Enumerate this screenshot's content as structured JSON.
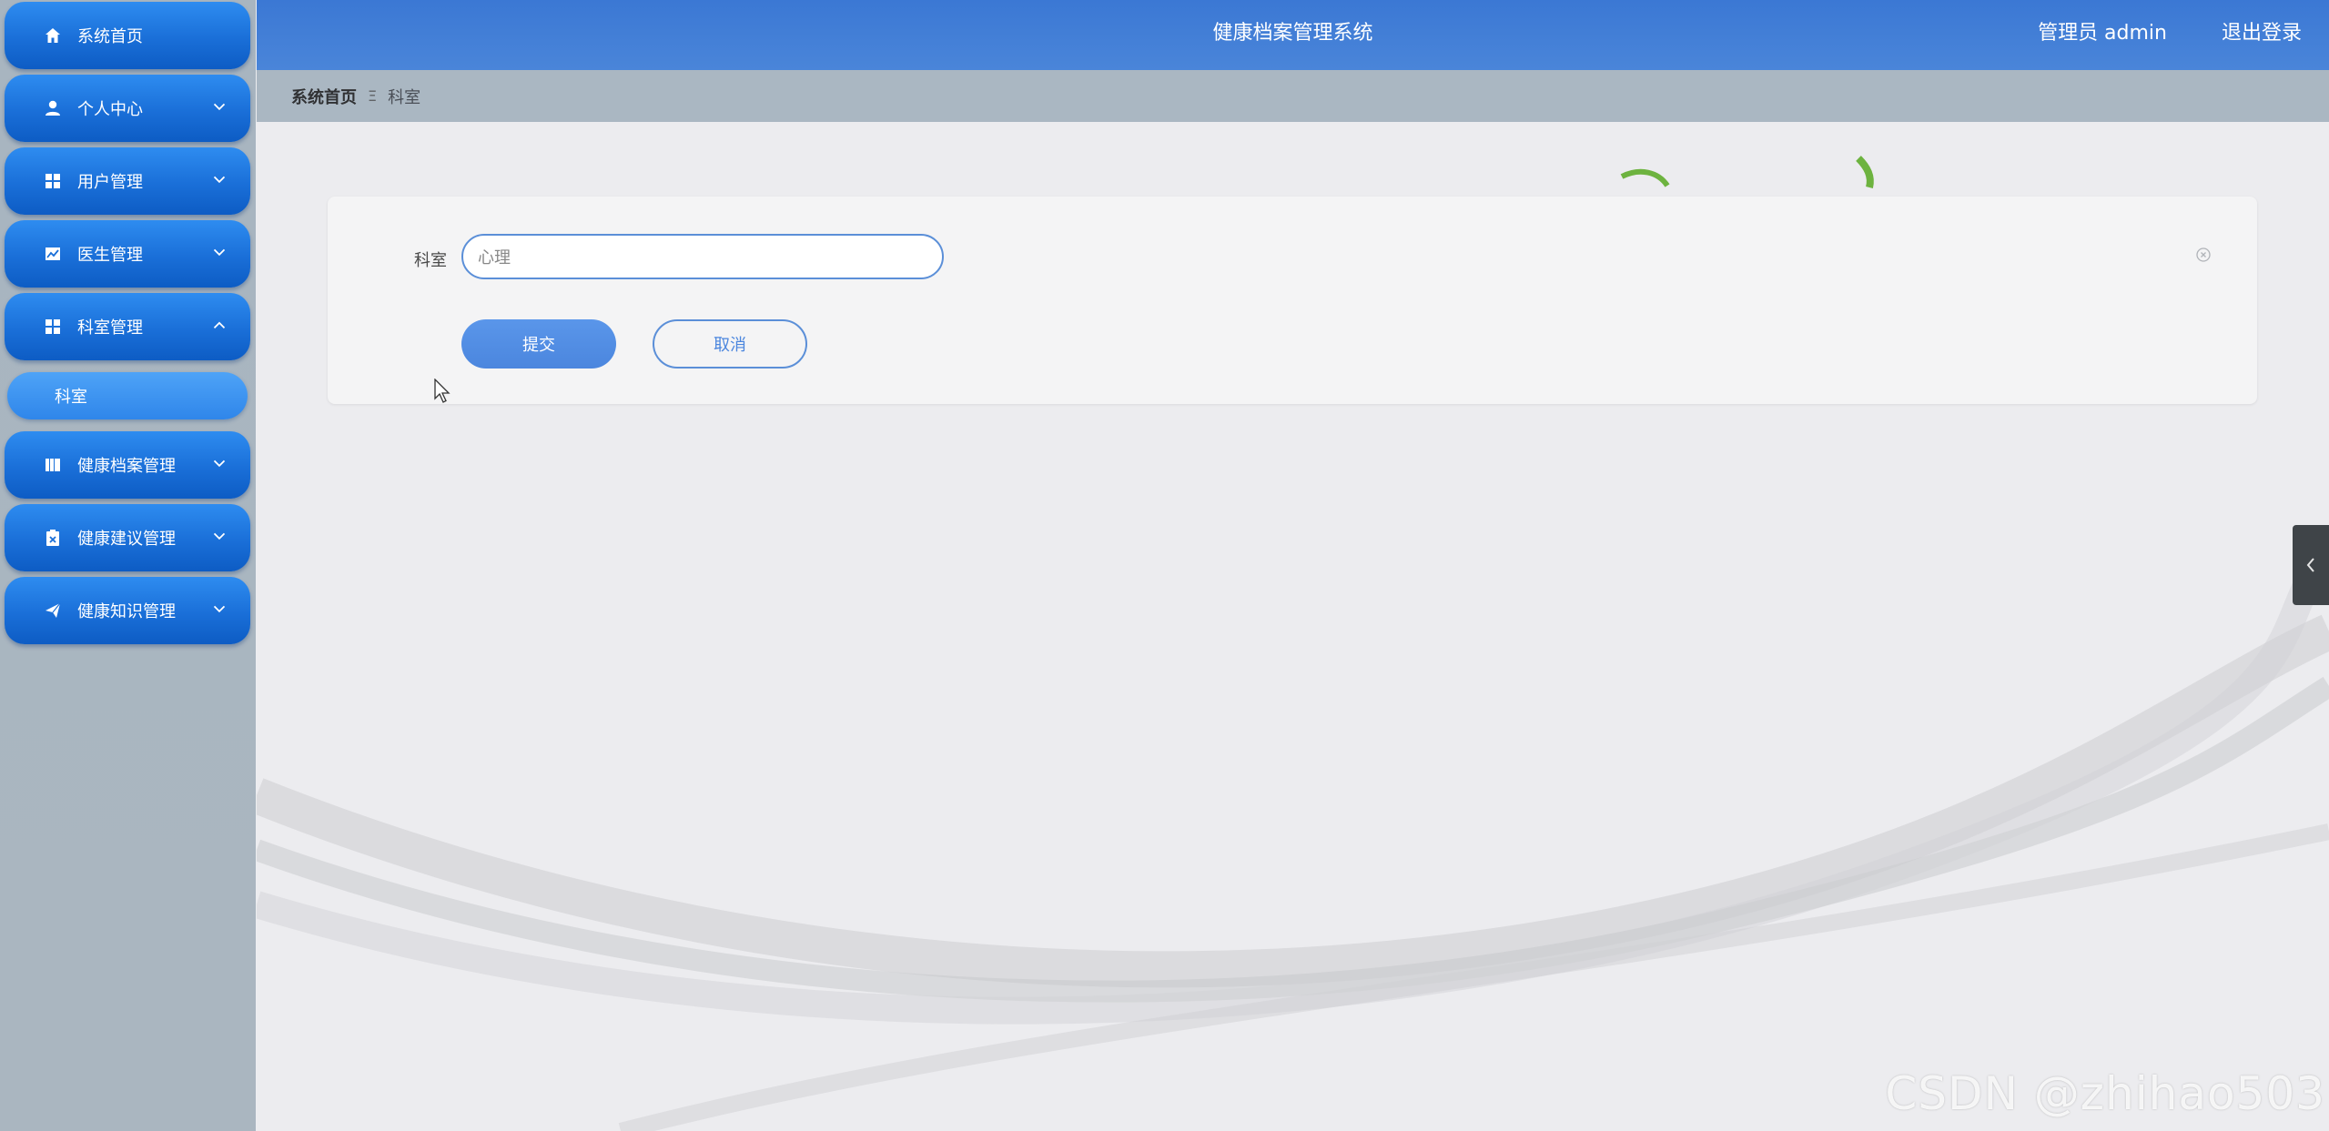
{
  "sidebar": {
    "items": [
      {
        "label": "系统首页",
        "icon": "home-icon",
        "expandable": false
      },
      {
        "label": "个人中心",
        "icon": "user-icon",
        "expandable": true
      },
      {
        "label": "用户管理",
        "icon": "grid-icon",
        "expandable": true
      },
      {
        "label": "医生管理",
        "icon": "chart-icon",
        "expandable": true
      },
      {
        "label": "科室管理",
        "icon": "grid-icon",
        "expandable": true,
        "expanded": true
      },
      {
        "label": "健康档案管理",
        "icon": "book-icon",
        "expandable": true
      },
      {
        "label": "健康建议管理",
        "icon": "clipboard-icon",
        "expandable": true
      },
      {
        "label": "健康知识管理",
        "icon": "send-icon",
        "expandable": true
      }
    ],
    "sub_item": {
      "label": "科室"
    }
  },
  "header": {
    "title": "健康档案管理系统",
    "user": "管理员 admin",
    "logout": "退出登录"
  },
  "breadcrumb": {
    "home": "系统首页",
    "separator": "Ξ",
    "current": "科室"
  },
  "form": {
    "field_label": "科室",
    "field_value": "心理",
    "submit_label": "提交",
    "cancel_label": "取消"
  },
  "watermark": "CSDN @zhihao503",
  "colors": {
    "accent": "#3b78d4",
    "nav_button": "#1a6fd8",
    "button_primary": "#4b86de"
  }
}
